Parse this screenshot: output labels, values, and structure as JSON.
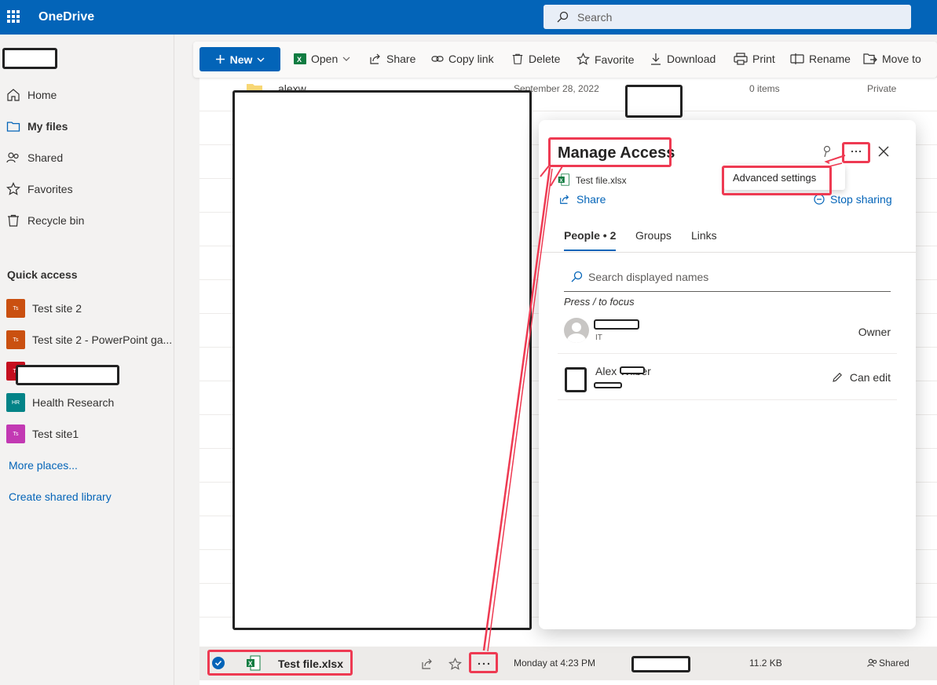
{
  "topbar": {
    "app_name": "OneDrive",
    "search_placeholder": "Search"
  },
  "nav": {
    "items": [
      {
        "label": "Home",
        "icon": "home-icon"
      },
      {
        "label": "My files",
        "icon": "folder-icon"
      },
      {
        "label": "Shared",
        "icon": "people-icon"
      },
      {
        "label": "Favorites",
        "icon": "star-icon"
      },
      {
        "label": "Recycle bin",
        "icon": "recycle-bin-icon"
      }
    ],
    "quick_access_title": "Quick access",
    "sites": [
      {
        "label": "Test site 2",
        "abbr": "Ts",
        "color": "#ca5010"
      },
      {
        "label": "Test site 2 - PowerPoint ga...",
        "abbr": "Ts",
        "color": "#ca5010"
      },
      {
        "label": "",
        "abbr": "Ts",
        "color": "#c50f1f"
      },
      {
        "label": "Health Research",
        "abbr": "HR",
        "color": "#038387"
      },
      {
        "label": "Test site1",
        "abbr": "Ts",
        "color": "#c239b3"
      }
    ],
    "more_places": "More places...",
    "create_library": "Create shared library"
  },
  "commandbar": {
    "new_label": "New",
    "commands": [
      "Open",
      "Share",
      "Copy link",
      "Delete",
      "Favorite",
      "Download",
      "Print",
      "Rename",
      "Move to"
    ]
  },
  "filelist": {
    "first_row": {
      "name": "alexw",
      "date": "September 28, 2022",
      "size": "0 items",
      "sharing": "Private"
    },
    "selected_row": {
      "name": "Test file.xlsx",
      "date": "Monday at 4:23 PM",
      "size": "11.2 KB",
      "sharing": "Shared"
    }
  },
  "dialog": {
    "title": "Manage Access",
    "file_name": "Test file.xlsx",
    "share_label": "Share",
    "stop_sharing_label": "Stop sharing",
    "menu_item": "Advanced settings",
    "tabs": [
      "People • 2",
      "Groups",
      "Links"
    ],
    "search_placeholder": "Search displayed names",
    "hint": "Press / to focus",
    "people": [
      {
        "subtitle": "IT",
        "role": "Owner"
      },
      {
        "name": "Alex Wilber",
        "role": "Can edit"
      }
    ]
  },
  "colors": {
    "brand": "#0364b8",
    "annotation": "#ee3a52"
  }
}
